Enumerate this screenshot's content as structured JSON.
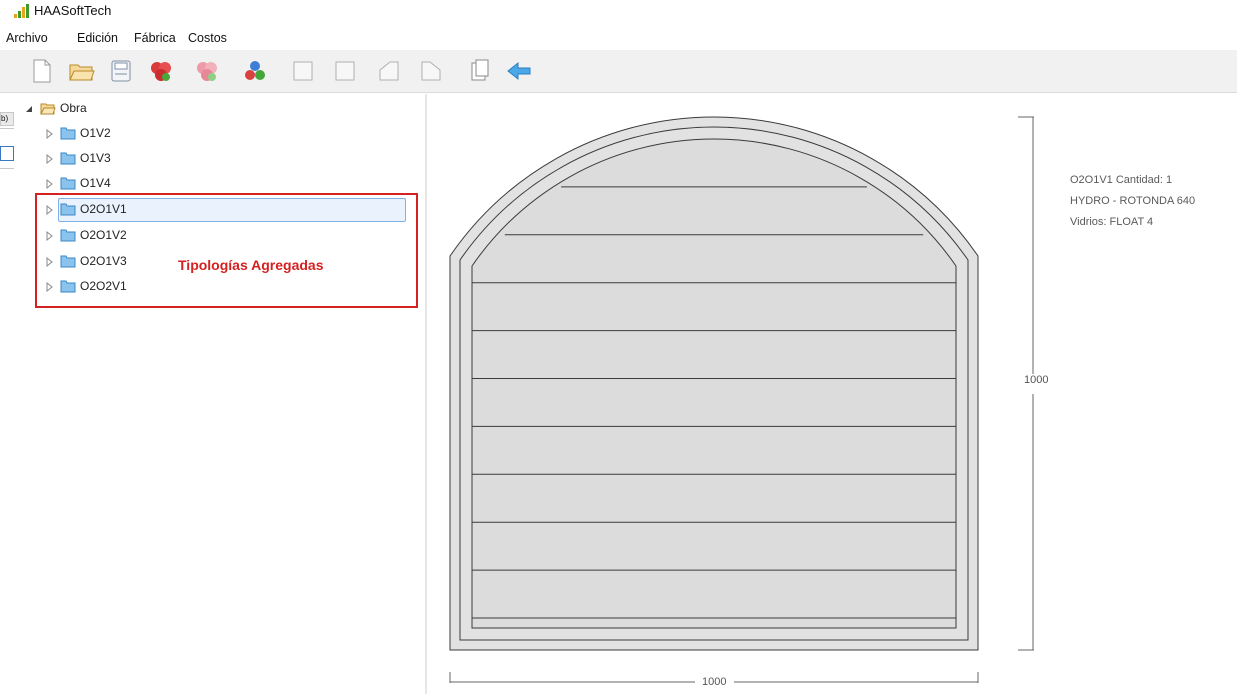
{
  "app": {
    "title": "HAASoftTech"
  },
  "menu": {
    "items": [
      "Archivo",
      "Edición",
      "Fábrica",
      "Costos"
    ]
  },
  "toolbar": {
    "buttons": [
      "new-doc-icon",
      "open-folder-icon",
      "save-icon",
      "add-red-typology-icon",
      "add-pink-typology-icon",
      "multicolor-assembly-icon",
      "frame-view-icon",
      "frame-view-alt-icon",
      "left-trapeze-icon",
      "right-trapeze-icon",
      "copy-doc-icon",
      "back-arrow-icon"
    ]
  },
  "left_stub": {
    "fragment_text": "b)"
  },
  "tree": {
    "root": "Obra",
    "nodes": [
      "O1V2",
      "O1V3",
      "O1V4",
      "O2O1V1",
      "O2O1V2",
      "O2O1V3",
      "O2O2V1"
    ],
    "selected": "O2O1V1"
  },
  "annotation": {
    "text": "Tipologías Agregadas",
    "color": "#d42121"
  },
  "info": {
    "line1": "O2O1V1 Cantidad: 1",
    "line2": "HYDRO - ROTONDA 640",
    "line3": "Vidrios: FLOAT 4"
  },
  "dimensions": {
    "width": "1000",
    "height": "1000"
  },
  "drawing": {
    "glass_panes": 10,
    "frame_fill": "#e2e2e2",
    "glass_fill": "#dcdcdc",
    "line_color": "#3a3a3a"
  }
}
